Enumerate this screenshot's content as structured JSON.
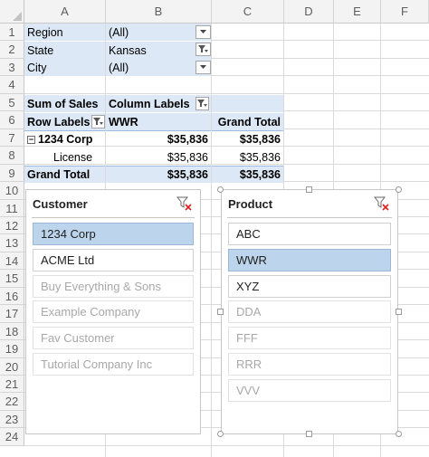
{
  "columns": [
    "A",
    "B",
    "C",
    "D",
    "E",
    "F"
  ],
  "rows": [
    "1",
    "2",
    "3",
    "4",
    "5",
    "6",
    "7",
    "8",
    "9",
    "10",
    "11",
    "12",
    "13",
    "14",
    "15",
    "16",
    "17",
    "18",
    "19",
    "20",
    "21",
    "22",
    "23",
    "24"
  ],
  "filters": [
    {
      "label": "Region",
      "value": "(All)"
    },
    {
      "label": "State",
      "value": "Kansas"
    },
    {
      "label": "City",
      "value": "(All)"
    }
  ],
  "pivot": {
    "sum_label": "Sum of Sales",
    "column_labels": "Column Labels",
    "row_labels": "Row Labels",
    "col_wwr": "WWR",
    "grand_total_header": "Grand Total",
    "company": "1234 Corp",
    "company_wwr": "$35,836",
    "company_total": "$35,836",
    "license": "License",
    "license_wwr": "$35,836",
    "license_total": "$35,836",
    "grand_total_label": "Grand Total",
    "grand_wwr": "$35,836",
    "grand_total": "$35,836",
    "collapse_symbol": "−"
  },
  "slicer_customer": {
    "title": "Customer",
    "items": [
      {
        "label": "1234 Corp",
        "state": "selected"
      },
      {
        "label": "ACME Ltd",
        "state": "available"
      },
      {
        "label": "Buy Everything & Sons",
        "state": "nodata"
      },
      {
        "label": "Example Company",
        "state": "nodata"
      },
      {
        "label": "Fav Customer",
        "state": "nodata"
      },
      {
        "label": "Tutorial Company Inc",
        "state": "nodata"
      }
    ]
  },
  "slicer_product": {
    "title": "Product",
    "items": [
      {
        "label": "ABC",
        "state": "available"
      },
      {
        "label": "WWR",
        "state": "selected"
      },
      {
        "label": "XYZ",
        "state": "available"
      },
      {
        "label": "DDA",
        "state": "nodata"
      },
      {
        "label": "FFF",
        "state": "nodata"
      },
      {
        "label": "RRR",
        "state": "nodata"
      },
      {
        "label": "VVV",
        "state": "nodata"
      }
    ]
  },
  "colors": {
    "pivot_fill": "#dce8f5",
    "slicer_selected": "#bcd4ec",
    "clear_filter_x": "#e02020"
  },
  "icons": {
    "dropdown": "dropdown-arrow-icon",
    "filter": "filter-icon",
    "clear_filter": "clear-filter-icon"
  }
}
